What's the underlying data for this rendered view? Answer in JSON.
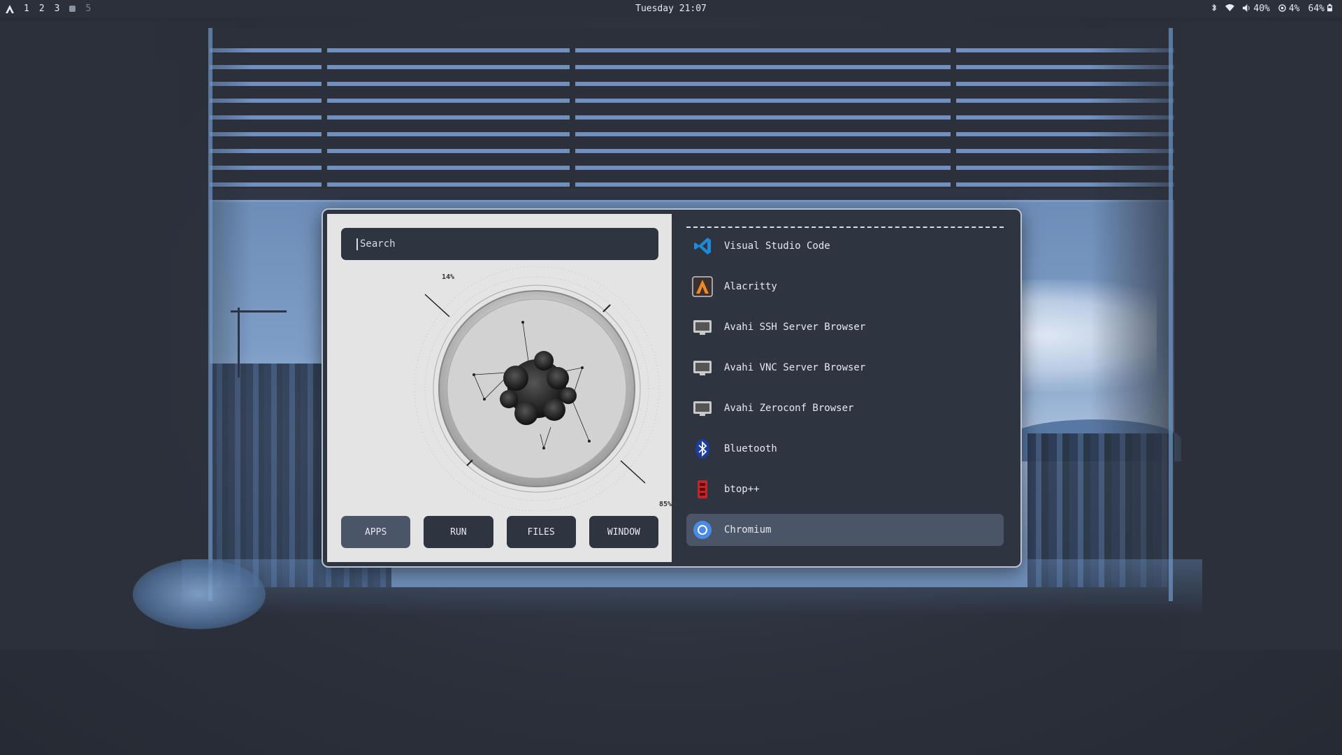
{
  "topbar": {
    "workspaces": [
      "1",
      "2",
      "3",
      "5"
    ],
    "clock": "Tuesday 21:07",
    "volume": "40%",
    "cpu": "4%",
    "battery": "64%"
  },
  "launcher": {
    "search": {
      "placeholder": "Search",
      "value": ""
    },
    "stats": {
      "top": "14%",
      "bottom": "85%"
    },
    "modes": [
      "APPS",
      "RUN",
      "FILES",
      "WINDOW"
    ],
    "active_mode": "APPS",
    "apps": [
      {
        "name": "Visual Studio Code",
        "icon": "vscode-icon"
      },
      {
        "name": "Alacritty",
        "icon": "alacritty-icon"
      },
      {
        "name": "Avahi SSH Server Browser",
        "icon": "network-icon"
      },
      {
        "name": "Avahi VNC Server Browser",
        "icon": "network-icon"
      },
      {
        "name": "Avahi Zeroconf Browser",
        "icon": "network-icon"
      },
      {
        "name": "Bluetooth",
        "icon": "bluetooth-icon"
      },
      {
        "name": "btop++",
        "icon": "btop-icon"
      },
      {
        "name": "Chromium",
        "icon": "chromium-icon"
      }
    ],
    "selected_app": "Chromium"
  },
  "colors": {
    "background": "#2b303b",
    "panel": "#2e3440",
    "selected": "#4b5568",
    "accent": "#6f97c9"
  }
}
